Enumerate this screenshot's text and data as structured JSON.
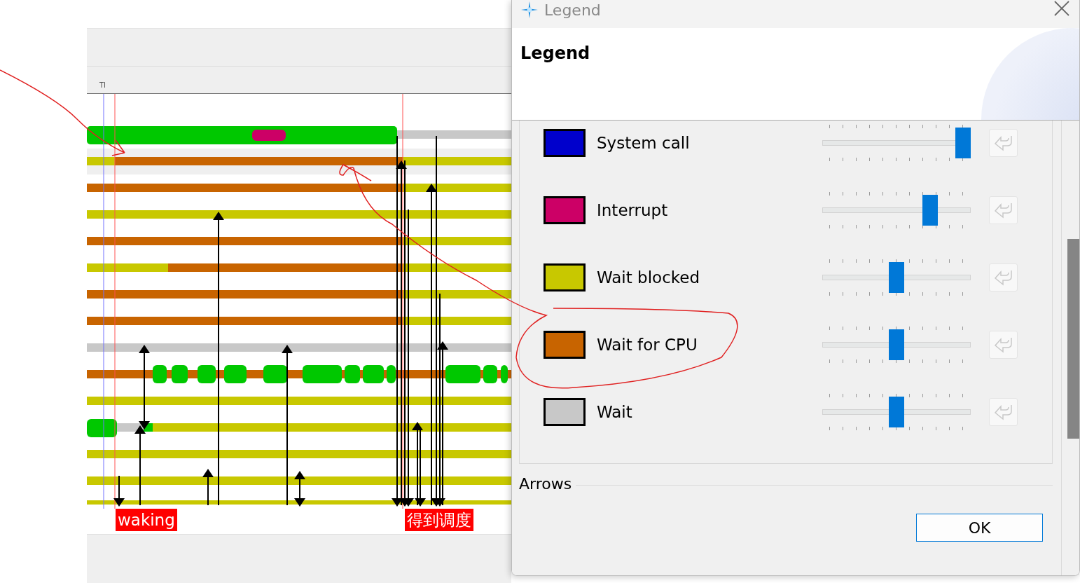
{
  "timeline": {
    "header": "TI",
    "annotations": [
      {
        "text": "waking"
      },
      {
        "text": "得到调度"
      }
    ]
  },
  "dialog": {
    "title": "Legend",
    "heading": "Legend",
    "items": [
      {
        "label": "System call",
        "color": "#0000cc",
        "level": 1,
        "reset_disabled": true
      },
      {
        "label": "Interrupt",
        "color": "#cc0066",
        "level": 0.75,
        "reset_disabled": true
      },
      {
        "label": "Wait blocked",
        "color": "#c8c800",
        "level": 0.5,
        "reset_disabled": true
      },
      {
        "label": "Wait for CPU",
        "color": "#c86400",
        "level": 0.5,
        "reset_disabled": true
      },
      {
        "label": "Wait",
        "color": "#c8c8c8",
        "level": 0.5,
        "reset_disabled": true
      }
    ],
    "group_label": "Arrows",
    "ok_button": "OK"
  }
}
